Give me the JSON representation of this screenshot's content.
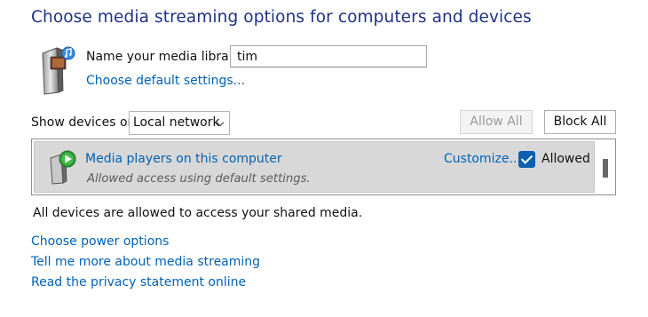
{
  "page": {
    "title": "Choose media streaming options for computers and devices"
  },
  "library": {
    "label": "Name your media library:",
    "value": "tim",
    "default_settings_link": "Choose default settings..."
  },
  "devices_toolbar": {
    "show_label": "Show devices on:",
    "network_selected": "Local network",
    "allow_all_label": "Allow All",
    "block_all_label": "Block All"
  },
  "devices": [
    {
      "name": "Media players on this computer",
      "status": "Allowed access using default settings.",
      "customize_label": "Customize...",
      "allowed_label": "Allowed",
      "allowed": true
    }
  ],
  "summary": "All devices are allowed to access your shared media.",
  "links": {
    "power": "Choose power options",
    "learn_more": "Tell me more about media streaming",
    "privacy": "Read the privacy statement online"
  },
  "colors": {
    "title": "#1e3287",
    "link": "#0062b6",
    "checkbox": "#0b5fb0",
    "row_background": "#d8d8d8"
  }
}
